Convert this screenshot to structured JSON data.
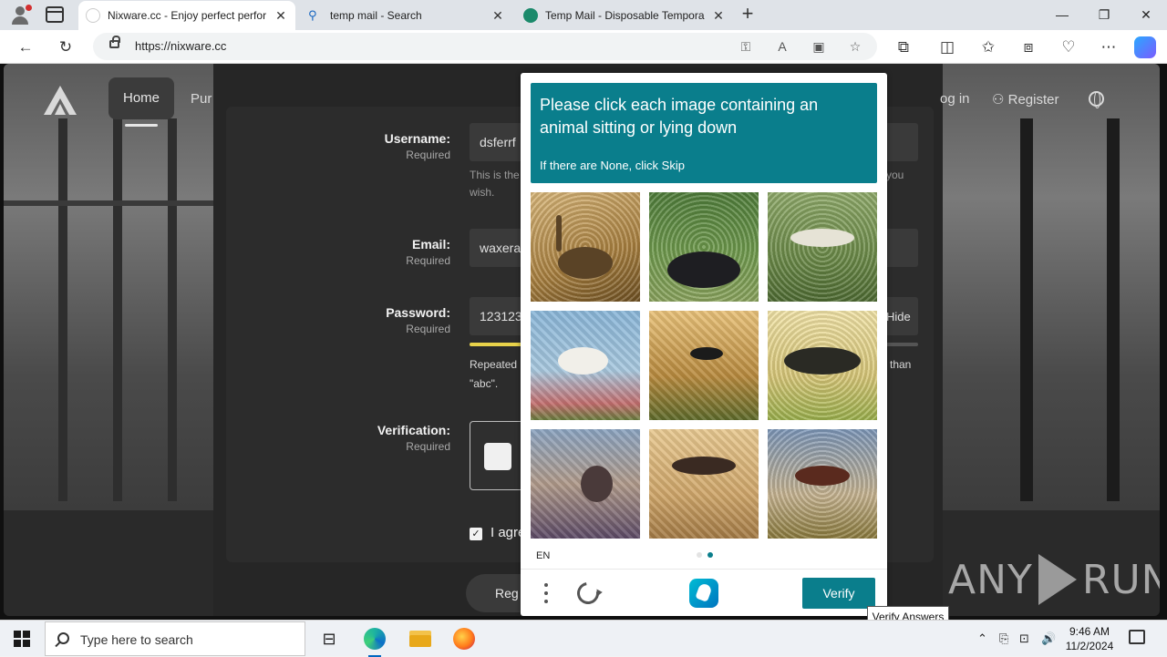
{
  "browser": {
    "tabs": [
      {
        "title": "Nixware.cc - Enjoy perfect perfor",
        "active": true
      },
      {
        "title": "temp mail - Search",
        "active": false
      },
      {
        "title": "Temp Mail - Disposable Tempora",
        "active": false
      }
    ],
    "url": "https://nixware.cc"
  },
  "site": {
    "nav": {
      "home": "Home",
      "purchase": "Pur",
      "login": "og in",
      "register": "Register"
    },
    "form": {
      "username_label": "Username:",
      "username_required": "Required",
      "username_value": "dsferrf",
      "username_help_left": "This is the",
      "username_help_right": "you",
      "username_help_line2": "wish.",
      "email_label": "Email:",
      "email_required": "Required",
      "email_value": "waxera",
      "password_label": "Password:",
      "password_required": "Required",
      "password_value": "123123",
      "password_toggle": "Hide",
      "password_help_left": "Repeated",
      "password_help_right": "than",
      "password_help_line2": "\"abc\".",
      "verification_label": "Verification:",
      "verification_required": "Required",
      "agree_text": "I agre",
      "register_button": "Reg"
    },
    "watermark": {
      "left": "ANY",
      "right": "RUN"
    }
  },
  "captcha": {
    "title": "Please click each image containing an animal sitting or lying down",
    "subtitle": "If there are None, click Skip",
    "language": "EN",
    "verify_button": "Verify",
    "tooltip": "Verify Answers",
    "images": [
      {
        "name": "ostrich-lying-sepia"
      },
      {
        "name": "ostrich-lying-dark"
      },
      {
        "name": "bird-wings-spread-green"
      },
      {
        "name": "white-bird-flowers"
      },
      {
        "name": "bird-silhouette-sunset"
      },
      {
        "name": "bird-silhouette-wings"
      },
      {
        "name": "bird-street-blurred"
      },
      {
        "name": "bird-flying-sepia"
      },
      {
        "name": "bird-flying-field"
      }
    ]
  },
  "taskbar": {
    "search_placeholder": "Type here to search",
    "time": "9:46 AM",
    "date": "11/2/2024"
  },
  "colors": {
    "captcha_teal": "#0a7e8c",
    "browser_edge_blue": "#0067c0"
  }
}
